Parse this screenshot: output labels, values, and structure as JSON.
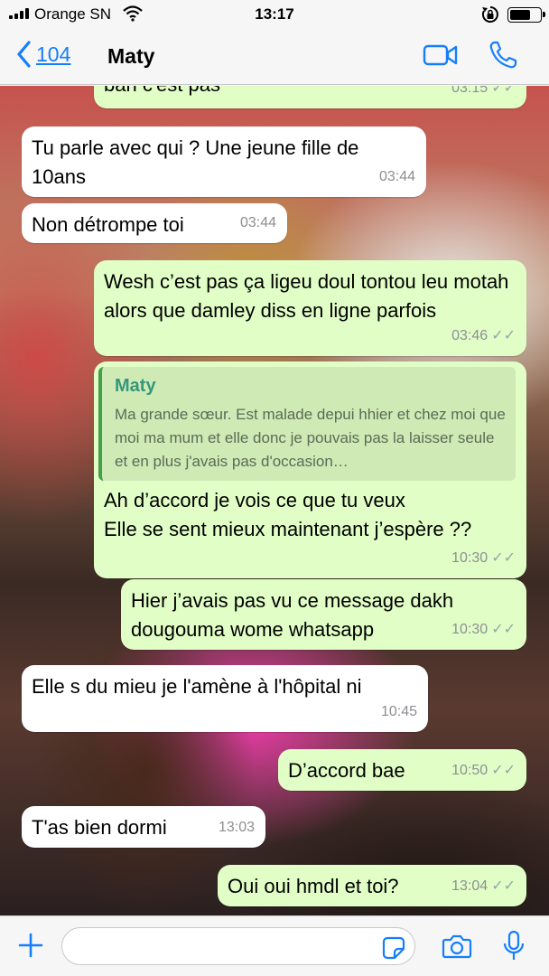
{
  "status_bar": {
    "carrier": "Orange SN",
    "time": "13:17"
  },
  "header": {
    "back_count": "104",
    "contact_name": "Maty"
  },
  "messages": [
    {
      "dir": "out",
      "text": "ban c'est pas",
      "time": "03:15"
    },
    {
      "dir": "in",
      "text": "Tu parle avec qui ? Une jeune fille de 10ans",
      "time": "03:44"
    },
    {
      "dir": "in",
      "text": "Non détrompe toi",
      "time": "03:44"
    },
    {
      "dir": "out",
      "text": "Wesh c’est pas ça ligeu doul tontou leu motah alors que damley diss en ligne parfois",
      "time": "03:46"
    },
    {
      "dir": "out",
      "quote_name": "Maty",
      "quote_text": "Ma grande sœur. Est malade depui hhier et chez moi que moi ma mum et elle donc je pouvais pas la laisser seule et en plus j'avais pas d'occasion…",
      "text": "Ah d’accord je vois ce que tu veux\nElle se sent mieux maintenant j’espère ??",
      "time": "10:30"
    },
    {
      "dir": "out",
      "text": "Hier j’avais pas vu ce message dakh dougouma wome whatsapp",
      "time": "10:30"
    },
    {
      "dir": "in",
      "text": "Elle s du mieu je l'amène à l'hôpital ni",
      "time": "10:45"
    },
    {
      "dir": "out",
      "text": "D’accord bae",
      "time": "10:50"
    },
    {
      "dir": "in",
      "text": "T'as bien dormi",
      "time": "13:03"
    },
    {
      "dir": "out",
      "text": "Oui oui hmdl et toi?",
      "time": "13:04"
    }
  ],
  "input": {
    "placeholder": ""
  },
  "colors": {
    "accent": "#157efb",
    "outgoing": "#e1fec6",
    "incoming": "#ffffff",
    "quote_name": "#35977f"
  },
  "icons": [
    "back-chevron-icon",
    "video-call-icon",
    "phone-call-icon",
    "plus-icon",
    "sticker-icon",
    "camera-icon",
    "microphone-icon"
  ]
}
